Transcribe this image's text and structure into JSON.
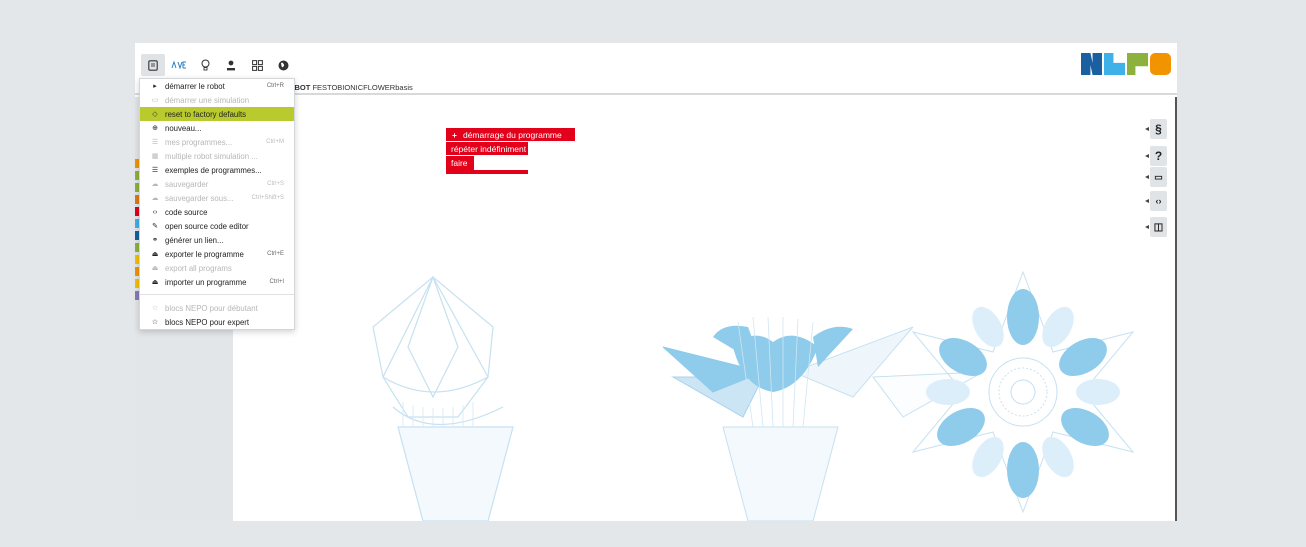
{
  "robot": {
    "prefix": "ON DU ROBOT",
    "name": "FESTOBIONICFLOWERbasis"
  },
  "toolbar": {
    "icons": [
      "program-menu-icon",
      "robot-menu-icon",
      "help-icon",
      "user-icon",
      "gallery-icon",
      "language-icon"
    ]
  },
  "logo": {
    "colors": [
      "#1a5fa0",
      "#3eb1e8",
      "#8cb23d",
      "#f29400"
    ]
  },
  "menu": {
    "items": [
      {
        "label": "démarrer le robot",
        "shortcut": "Ctrl+R",
        "icon": "▸"
      },
      {
        "label": "démarrer une simulation",
        "shortcut": "",
        "icon": "▭"
      },
      {
        "label": "reset to factory defaults",
        "shortcut": "",
        "icon": "◇"
      },
      {
        "label": "nouveau...",
        "shortcut": "",
        "icon": "⊕"
      },
      {
        "label": "mes programmes...",
        "shortcut": "Ctrl+M",
        "icon": "☰"
      },
      {
        "label": "multiple robot simulation ...",
        "shortcut": "",
        "icon": "▦"
      },
      {
        "label": "exemples de programmes...",
        "shortcut": "",
        "icon": "☰"
      },
      {
        "label": "sauvegarder",
        "shortcut": "Ctrl+S",
        "icon": "☁"
      },
      {
        "label": "sauvegarder sous...",
        "shortcut": "Ctrl+Shift+S",
        "icon": "☁"
      },
      {
        "label": "code source",
        "shortcut": "",
        "icon": "‹›"
      },
      {
        "label": "open source code editor",
        "shortcut": "",
        "icon": "✎"
      },
      {
        "label": "générer un lien...",
        "shortcut": "",
        "icon": "⚭"
      },
      {
        "label": "exporter le programme",
        "shortcut": "Ctrl+E",
        "icon": "⏏"
      },
      {
        "label": "export all programs",
        "shortcut": "",
        "icon": "⏏"
      },
      {
        "label": "importer un programme",
        "shortcut": "Ctrl+I",
        "icon": "⏏"
      },
      {
        "label": "blocs NEPO pour débutant",
        "shortcut": "",
        "icon": "☆"
      },
      {
        "label": "blocs NEPO pour expert",
        "shortcut": "",
        "icon": "☆"
      }
    ]
  },
  "blocks": {
    "start": {
      "symbol": "+",
      "label": "démarrage du programme"
    },
    "loop": "répéter indéfiniment",
    "do": "faire"
  },
  "sidebar": {
    "buttons": [
      {
        "label": "§",
        "icon": "section-icon"
      },
      {
        "label": "?",
        "icon": "help-icon"
      },
      {
        "label": "▭",
        "icon": "comment-icon"
      },
      {
        "label": "‹›",
        "icon": "code-icon"
      },
      {
        "label": "◫",
        "icon": "chat-icon"
      }
    ]
  },
  "colors": {
    "accent": "#b9ca2e",
    "block": "#e2001a",
    "flower": "#8fcbea"
  }
}
